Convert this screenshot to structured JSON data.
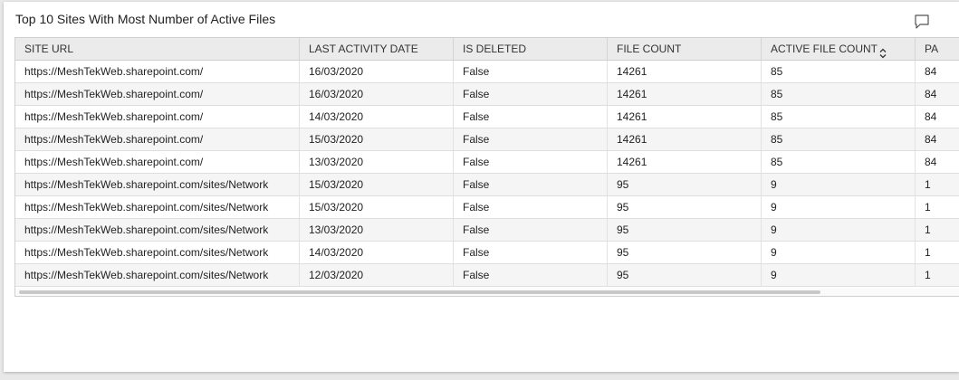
{
  "widget": {
    "title": "Top 10 Sites With Most Number of Active Files",
    "comment_icon": "comment-icon"
  },
  "table": {
    "columns": [
      "SITE URL",
      "LAST ACTIVITY DATE",
      "IS DELETED",
      "FILE COUNT",
      "ACTIVE FILE COUNT",
      "PA"
    ],
    "sorted_column": "ACTIVE FILE COUNT",
    "rows": [
      [
        "https://MeshTekWeb.sharepoint.com/",
        "16/03/2020",
        "False",
        "14261",
        "85",
        "84"
      ],
      [
        "https://MeshTekWeb.sharepoint.com/",
        "16/03/2020",
        "False",
        "14261",
        "85",
        "84"
      ],
      [
        "https://MeshTekWeb.sharepoint.com/",
        "14/03/2020",
        "False",
        "14261",
        "85",
        "84"
      ],
      [
        "https://MeshTekWeb.sharepoint.com/",
        "15/03/2020",
        "False",
        "14261",
        "85",
        "84"
      ],
      [
        "https://MeshTekWeb.sharepoint.com/",
        "13/03/2020",
        "False",
        "14261",
        "85",
        "84"
      ],
      [
        "https://MeshTekWeb.sharepoint.com/sites/Network",
        "15/03/2020",
        "False",
        "95",
        "9",
        "1"
      ],
      [
        "https://MeshTekWeb.sharepoint.com/sites/Network",
        "15/03/2020",
        "False",
        "95",
        "9",
        "1"
      ],
      [
        "https://MeshTekWeb.sharepoint.com/sites/Network",
        "13/03/2020",
        "False",
        "95",
        "9",
        "1"
      ],
      [
        "https://MeshTekWeb.sharepoint.com/sites/Network",
        "14/03/2020",
        "False",
        "95",
        "9",
        "1"
      ],
      [
        "https://MeshTekWeb.sharepoint.com/sites/Network",
        "12/03/2020",
        "False",
        "95",
        "9",
        "1"
      ]
    ]
  },
  "colors": {
    "header_bg": "#ebebeb",
    "alt_row_bg": "#f5f5f5",
    "border": "#cfcfcf"
  }
}
